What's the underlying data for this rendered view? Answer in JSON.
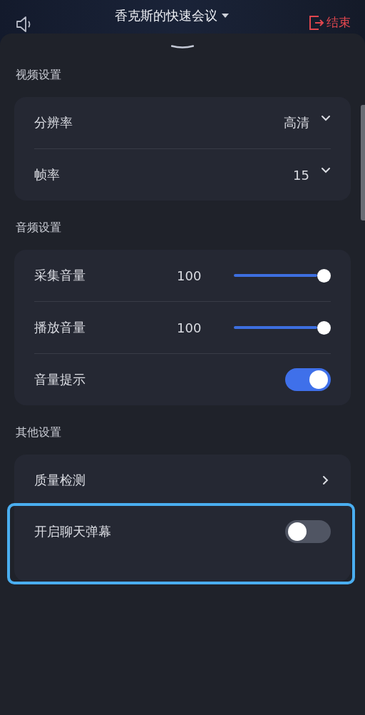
{
  "header": {
    "title": "香克斯的快速会议",
    "end_label": "结束"
  },
  "sections": [
    {
      "title": "视频设置",
      "items": [
        {
          "kind": "select",
          "label": "分辨率",
          "value": "高清",
          "highlighted": false
        },
        {
          "kind": "select",
          "label": "帧率",
          "value": "15",
          "highlighted": false
        }
      ]
    },
    {
      "title": "音频设置",
      "items": [
        {
          "kind": "slider",
          "label": "采集音量",
          "reading": "100",
          "level": 1,
          "highlighted": false
        },
        {
          "kind": "slider",
          "label": "播放音量",
          "reading": "100",
          "level": 1,
          "highlighted": false
        },
        {
          "kind": "switch",
          "label": "音量提示",
          "on": true,
          "highlighted": false
        }
      ]
    },
    {
      "title": "其他设置",
      "items": [
        {
          "kind": "link",
          "label": "质量检测",
          "highlighted": false
        },
        {
          "kind": "switch",
          "label": "开启聊天弹幕",
          "on": false,
          "highlighted": true
        }
      ]
    }
  ]
}
